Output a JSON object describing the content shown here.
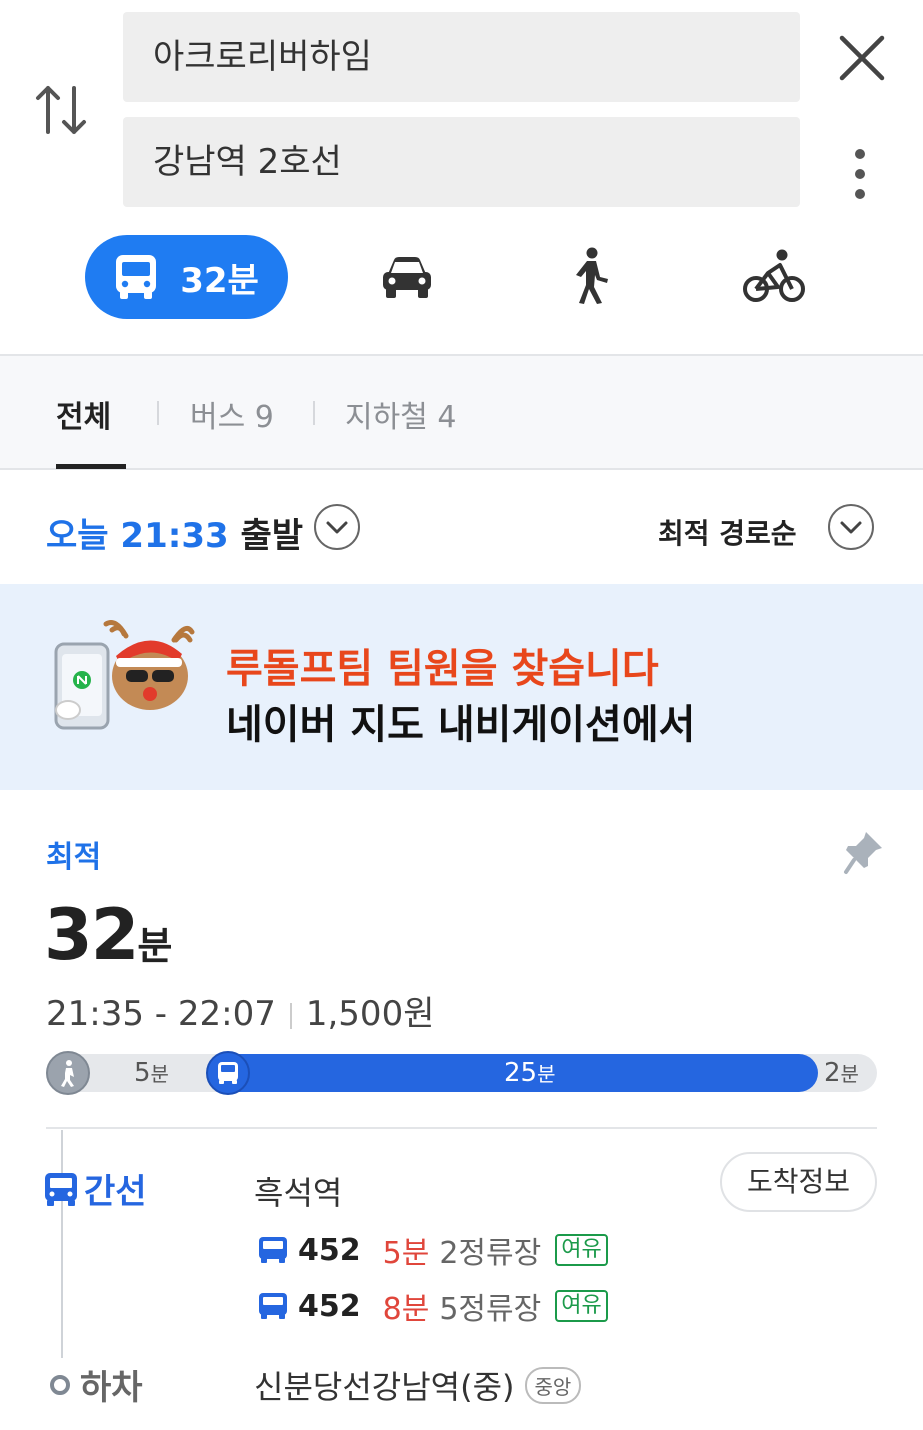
{
  "search": {
    "origin": "아크로리버하임",
    "destination": "강남역 2호선"
  },
  "modes": {
    "transit_label": "32분"
  },
  "tabs": [
    {
      "label": "전체"
    },
    {
      "label": "버스 9"
    },
    {
      "label": "지하철 4"
    }
  ],
  "depart": {
    "day": "오늘",
    "time": "21:33",
    "suffix": "출발"
  },
  "sort": {
    "label": "최적 경로순"
  },
  "banner": {
    "line1": "루돌프팀 팀원을 찾습니다",
    "line2": "네이버 지도 내비게이션에서"
  },
  "route": {
    "badge": "최적",
    "duration_num": "32",
    "duration_unit": "분",
    "time_range": "21:35 - 22:07",
    "fare": "1,500원",
    "segments": {
      "walk_num": "5",
      "walk_unit": "분",
      "bus_num": "25",
      "bus_unit": "분",
      "end_num": "2",
      "end_unit": "분"
    },
    "leg": {
      "kind": "간선",
      "stop": "흑석역",
      "arrival_button": "도착정보",
      "buses": [
        {
          "number": "452",
          "eta": "5분",
          "stops": "2정류장",
          "crowd": "여유"
        },
        {
          "number": "452",
          "eta": "8분",
          "stops": "5정류장",
          "crowd": "여유"
        }
      ]
    },
    "alight": {
      "kind": "하차",
      "stop": "신분당선강남역(중)",
      "tag": "중앙"
    }
  },
  "colors": {
    "accent": "#1f7cf2",
    "bus": "#2566e0",
    "eta": "#e0463b",
    "crowd": "#1b9a4a",
    "banner_red": "#e8471c"
  }
}
